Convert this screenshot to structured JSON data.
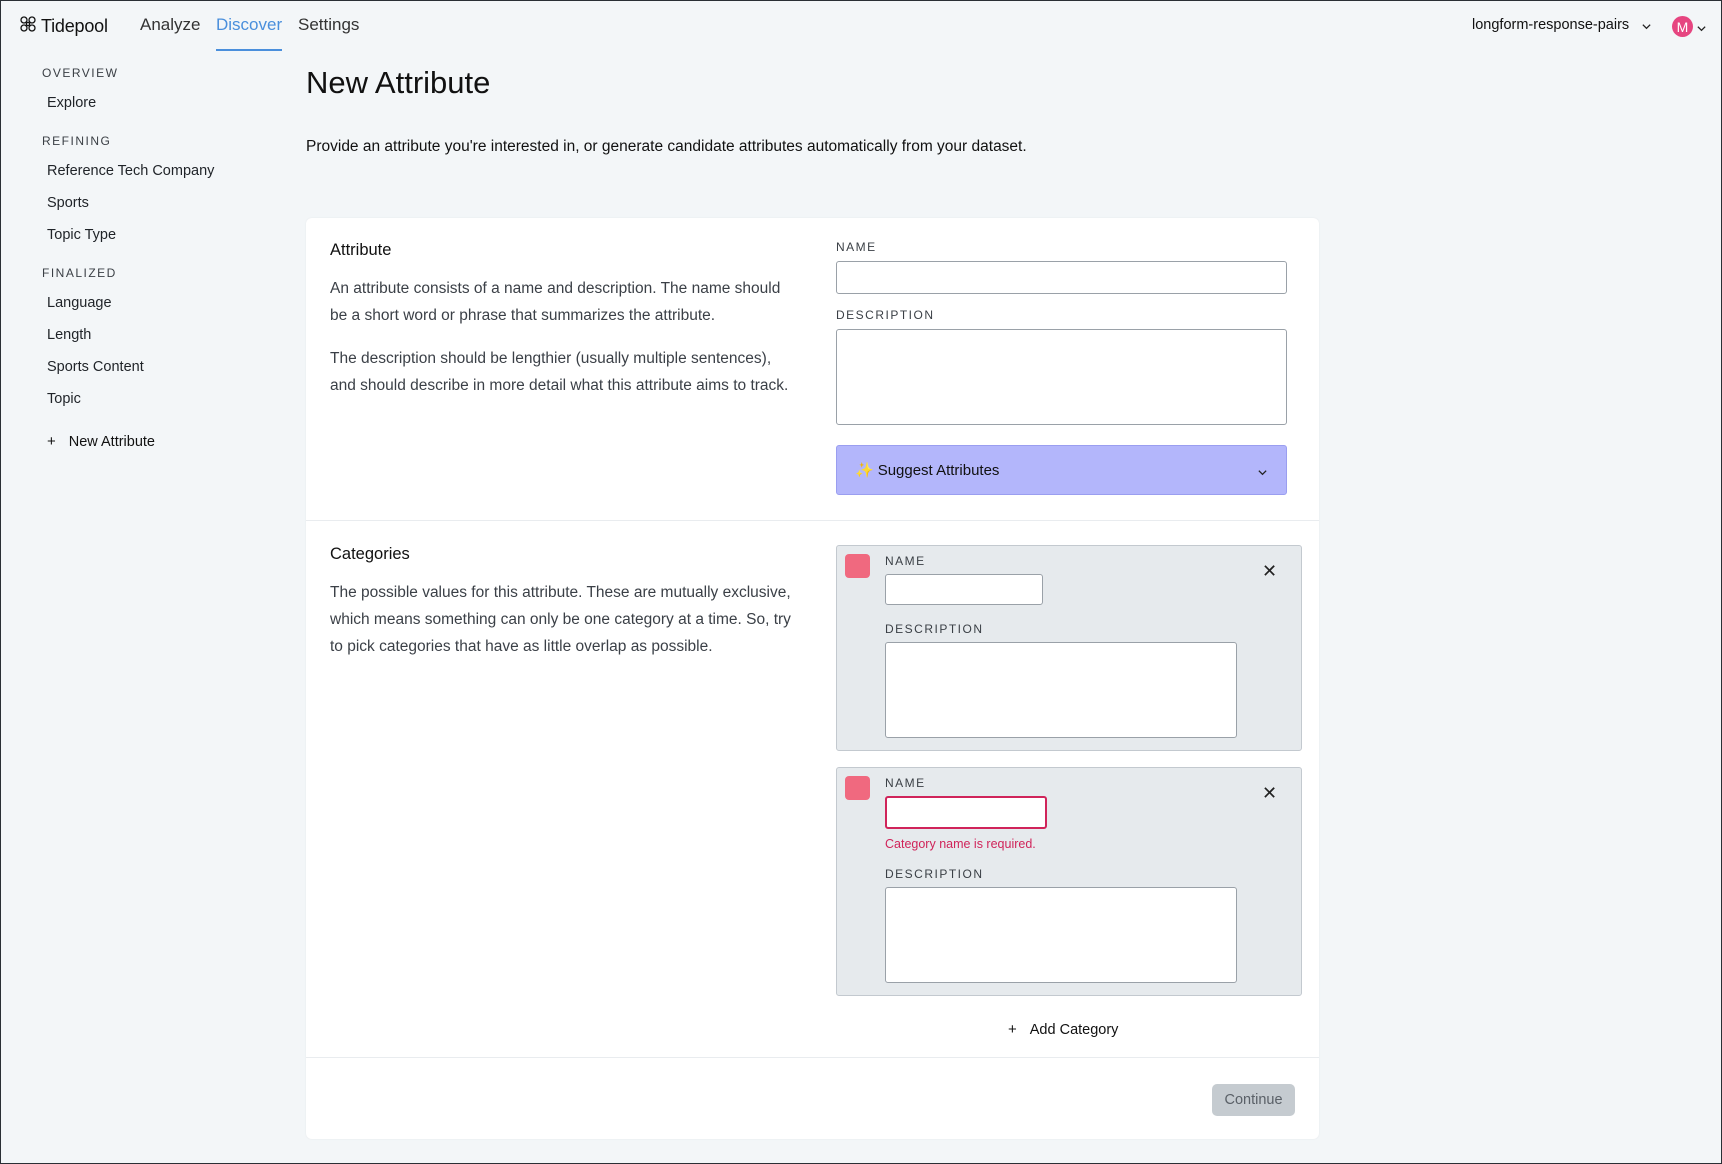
{
  "app": {
    "name": "Tidepool",
    "nav_tabs": [
      "Analyze",
      "Discover",
      "Settings"
    ],
    "active_tab": "Discover",
    "dataset": "longform-response-pairs",
    "avatar_initial": "M",
    "accent_color": "#4a8fdc",
    "avatar_color": "#e64580"
  },
  "sidebar": {
    "overview_label": "OVERVIEW",
    "overview_items": [
      "Explore"
    ],
    "refining_label": "REFINING",
    "refining_items": [
      "Reference Tech Company",
      "Sports",
      "Topic Type"
    ],
    "finalized_label": "FINALIZED",
    "finalized_items": [
      "Language",
      "Length",
      "Sports Content",
      "Topic"
    ],
    "new_attribute_label": "New Attribute"
  },
  "main": {
    "title": "New Attribute",
    "description": "Provide an attribute you're interested in, or generate candidate attributes automatically from your dataset.",
    "attribute_section": {
      "title": "Attribute",
      "text_1": "An attribute consists of a name and description. The name should be a short word or phrase that summarizes the attribute.",
      "text_2": "The description should be lengthier (usually multiple sentences), and should describe in more detail what this attribute aims to track.",
      "name_label": "NAME",
      "name_value": "",
      "description_label": "DESCRIPTION",
      "description_value": "",
      "suggest_button": "Suggest Attributes",
      "suggest_icon": "sparkles-icon",
      "suggest_color": "#b3b6fb"
    },
    "categories_section": {
      "title": "Categories",
      "text": "The possible values for this attribute. These are mutually exclusive, which means something can only be one category at a time. So, try to pick categories that have as little overlap as possible.",
      "categories": [
        {
          "name_label": "NAME",
          "name_value": "",
          "description_label": "DESCRIPTION",
          "description_value": "",
          "color": "#f0697f",
          "error": ""
        },
        {
          "name_label": "NAME",
          "name_value": "",
          "description_label": "DESCRIPTION",
          "description_value": "",
          "color": "#f0697f",
          "error": "Category name is required."
        }
      ],
      "add_category_label": "Add Category"
    },
    "continue_button": "Continue"
  }
}
